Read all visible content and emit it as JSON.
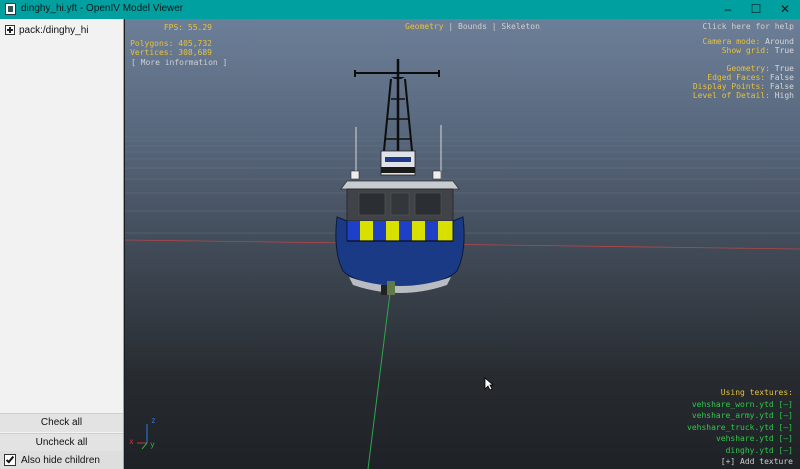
{
  "window": {
    "title": "dinghy_hi.yft - OpenIV Model Viewer",
    "minimize": "–",
    "maximize": "☐",
    "close": "✕"
  },
  "tree": {
    "root_label": "pack:/dinghy_hi"
  },
  "panel": {
    "check_all": "Check all",
    "uncheck_all": "Uncheck all",
    "also_hide_children": "Also hide children",
    "also_hide_children_checked": true
  },
  "hud": {
    "fps_label": "FPS:",
    "fps": "55.29",
    "polygons_label": "Polygons:",
    "polygons": "405,732",
    "vertices_label": "Vertices:",
    "vertices": "308,689",
    "more_info": "[ More information ]",
    "view_modes": {
      "geometry": "Geometry",
      "sep1": "|",
      "bounds": "Bounds",
      "sep2": "|",
      "skeleton": "Skeleton"
    },
    "help": "Click here for help",
    "camera_mode_label": "Camera mode:",
    "camera_mode": "Around",
    "show_grid_label": "Show grid:",
    "show_grid": "True",
    "geometry_label": "Geometry:",
    "geometry": "True",
    "edged_faces_label": "Edged Faces:",
    "edged_faces": "False",
    "display_points_label": "Display Points:",
    "display_points": "False",
    "lod_label": "Level of Detail:",
    "lod": "High",
    "using_textures": "Using textures:",
    "textures": [
      "vehshare_worn.ytd [–]",
      "vehshare_army.ytd [–]",
      "vehshare_truck.ytd [–]",
      "vehshare.ytd [–]",
      "dinghy.ytd [–]"
    ],
    "add_texture": "[+] Add texture",
    "axis_x": "x",
    "axis_y": "y",
    "axis_z": "z"
  },
  "colors": {
    "titlebar": "#00a0a0",
    "hud_label": "#e8c13c",
    "hud_value": "#d8d8d8",
    "texture_link": "#2fc84a",
    "hull_blue": "#1a3a86",
    "battenburg_yellow": "#d8e000",
    "battenburg_blue": "#1e40c8"
  }
}
